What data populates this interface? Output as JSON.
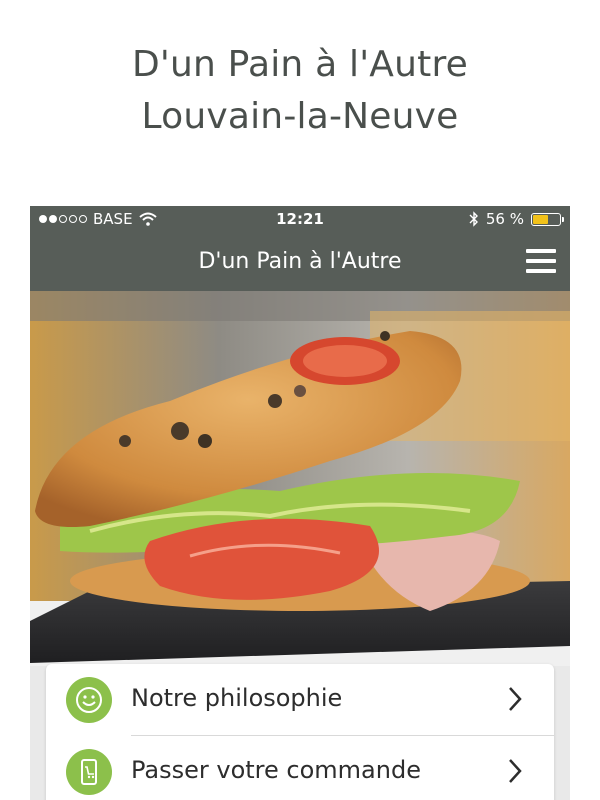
{
  "promo": {
    "title_line1": "D'un Pain à l'Autre",
    "title_line2": "Louvain-la-Neuve"
  },
  "status_bar": {
    "carrier": "BASE",
    "time": "12:21",
    "battery": "56 %",
    "battery_level": 0.56,
    "signal_bars_filled": 2,
    "signal_bars_total": 5
  },
  "navbar": {
    "title": "D'un Pain à l'Autre",
    "menu_icon": "hamburger-menu-icon"
  },
  "hero": {
    "image_subject": "sandwich-photo"
  },
  "menu": {
    "items": [
      {
        "label": "Notre philosophie",
        "icon": "smiley-icon"
      },
      {
        "label": "Passer votre commande",
        "icon": "mobile-cart-icon"
      }
    ]
  },
  "colors": {
    "bar": "#575d58",
    "accent_green": "#8cc04b",
    "battery": "#f2c21a",
    "title_text": "#4a4f4c"
  }
}
